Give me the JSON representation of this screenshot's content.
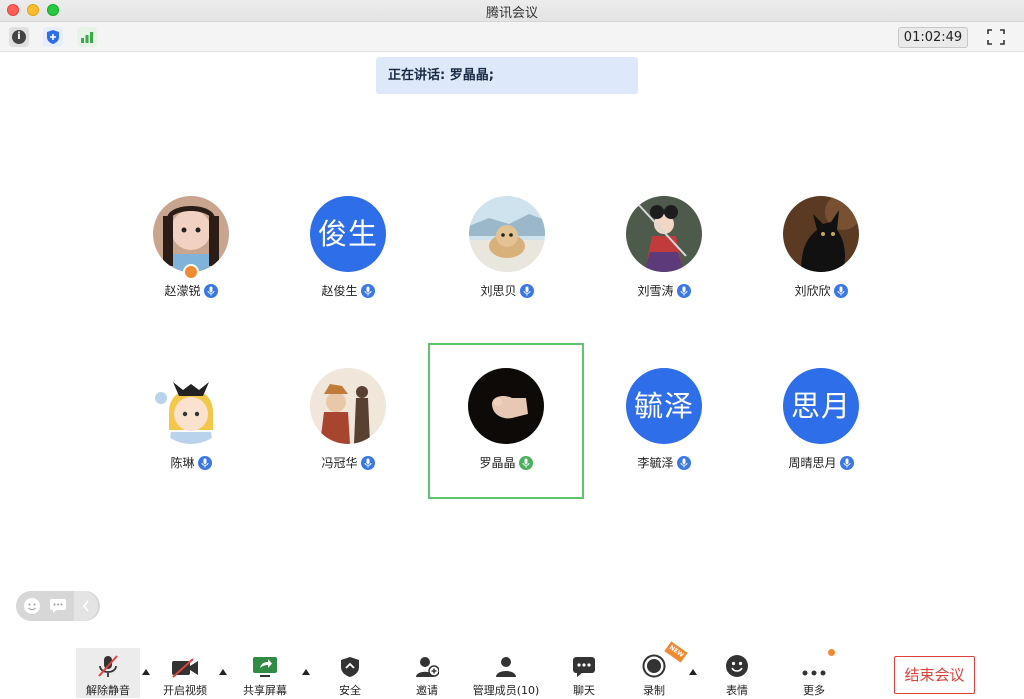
{
  "window": {
    "title": "腾讯会议"
  },
  "toolbar": {
    "timer": "01:02:49"
  },
  "speaking": {
    "text": "正在讲话: 罗晶晶;"
  },
  "participants": [
    {
      "name": "赵濛锐",
      "avatar_type": "photo",
      "avatar_text": "",
      "host": true
    },
    {
      "name": "赵俊生",
      "avatar_type": "text",
      "avatar_text": "俊生",
      "host": false
    },
    {
      "name": "刘思贝",
      "avatar_type": "photo",
      "avatar_text": "",
      "host": false
    },
    {
      "name": "刘雪涛",
      "avatar_type": "photo",
      "avatar_text": "",
      "host": false
    },
    {
      "name": "刘欣欣",
      "avatar_type": "photo",
      "avatar_text": "",
      "host": false
    },
    {
      "name": "陈琳",
      "avatar_type": "photo",
      "avatar_text": "",
      "host": false
    },
    {
      "name": "冯冠华",
      "avatar_type": "photo",
      "avatar_text": "",
      "host": false
    },
    {
      "name": "罗晶晶",
      "avatar_type": "photo",
      "avatar_text": "",
      "host": false,
      "speaking": true
    },
    {
      "name": "李毓泽",
      "avatar_type": "text",
      "avatar_text": "毓泽",
      "host": false
    },
    {
      "name": "周晴思月",
      "avatar_type": "text",
      "avatar_text": "思月",
      "host": false
    }
  ],
  "bottom_bar": {
    "unmute": "解除静音",
    "start_video": "开启视频",
    "share_screen": "共享屏幕",
    "security": "安全",
    "invite": "邀请",
    "manage_members": "管理成员(10)",
    "chat": "聊天",
    "record": "录制",
    "record_tag": "NEW",
    "emoji": "表情",
    "more": "更多",
    "end_meeting": "结束会议"
  },
  "colors": {
    "accent": "#2e6ee8",
    "speaking_border": "#5fc56c",
    "end": "#e0413a",
    "badge": "#f08a32"
  }
}
